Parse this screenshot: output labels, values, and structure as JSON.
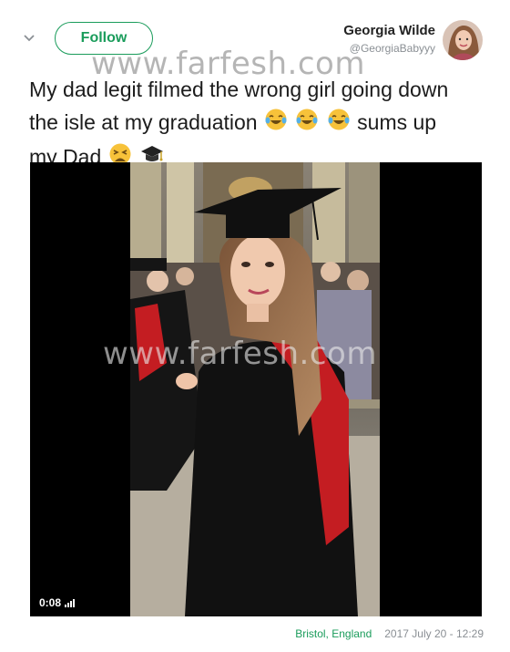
{
  "header": {
    "follow_label": "Follow",
    "user_name": "Georgia Wilde",
    "user_handle": "@GeorgiaBabyyy"
  },
  "tweet": {
    "line1": "My dad legit filmed the wrong girl going down",
    "line2_text": "the isle at my graduation",
    "line2_tail": "sums up",
    "line3_text": "my Dad"
  },
  "video": {
    "duration": "0:08"
  },
  "watermark": {
    "top": "www.farfesh.com",
    "middle": "www.farfesh.com"
  },
  "footer": {
    "location": "Bristol, England",
    "datetime": "2017 July 20 - 12:29"
  },
  "icons": {
    "chevron": "chevron-down-icon",
    "laughing": "tears-of-joy-emoji",
    "weary": "weary-face-emoji",
    "cap": "graduation-cap-emoji",
    "volume": "volume-bars-icon"
  },
  "colors": {
    "accent": "#1a9c5b",
    "muted": "#8a8f94",
    "video_bg": "#000000"
  }
}
